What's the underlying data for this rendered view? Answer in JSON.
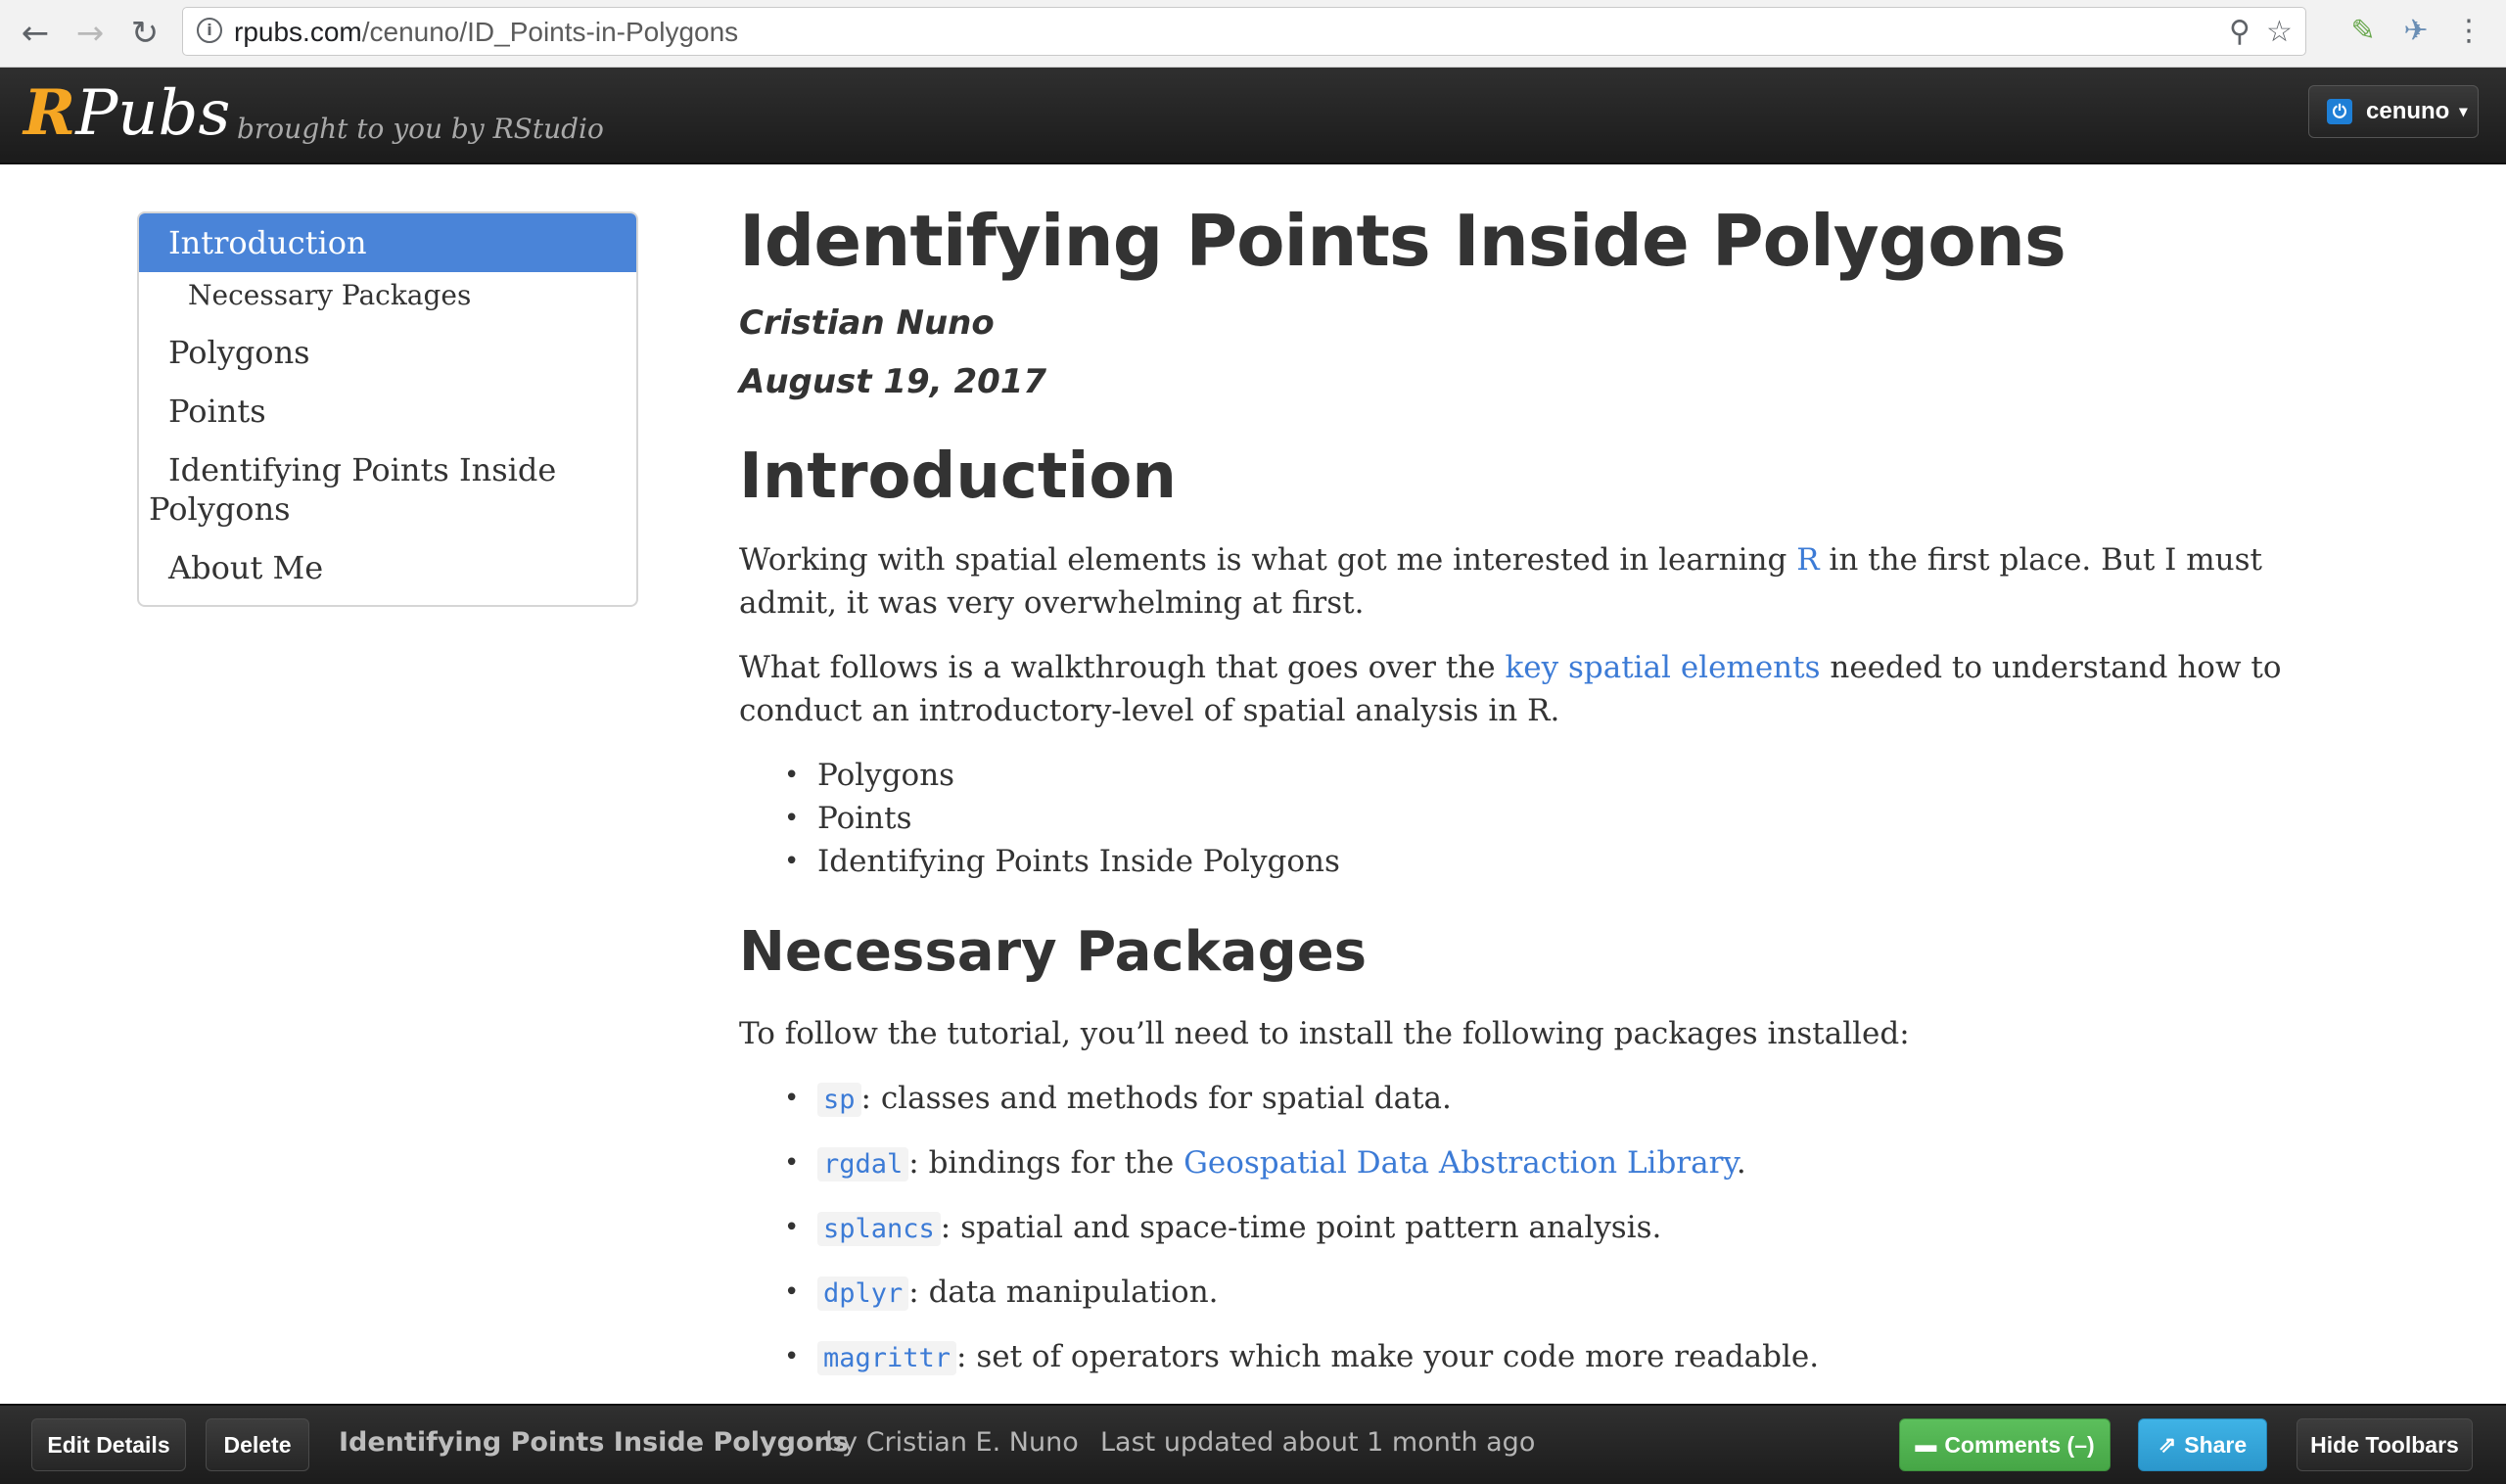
{
  "browser": {
    "url_host": "rpubs.com",
    "url_path": "/cenuno/ID_Points-in-Polygons",
    "back_icon": "←",
    "forward_icon": "→",
    "reload_icon": "↻",
    "info_icon": "i",
    "pin_icon": "⚲",
    "star_icon": "☆",
    "ext1_icon": "✎",
    "ext2_icon": "✈",
    "menu_icon": "⋮"
  },
  "header": {
    "logo_r": "R",
    "logo_rest": "Pubs",
    "tagline": "brought to you by RStudio",
    "user_name": "cenuno",
    "power_icon": "⏻",
    "caret_icon": "▾"
  },
  "toc": {
    "items": [
      {
        "label": "Introduction"
      },
      {
        "label": "Necessary Packages"
      },
      {
        "label": "Polygons"
      },
      {
        "label": "Points"
      },
      {
        "label": "Identifying Points Inside"
      },
      {
        "label": "Polygons"
      },
      {
        "label": "About Me"
      }
    ]
  },
  "doc": {
    "title": "Identifying Points Inside Polygons",
    "author": "Cristian Nuno",
    "date": "August 19, 2017",
    "intro_heading": "Introduction",
    "intro_p1_before": "Working with spatial elements is what got me interested in learning ",
    "intro_p1_link": "R",
    "intro_p1_after": " in the first place. But I must admit, it was very overwhelming at first.",
    "intro_p2_before": "What follows is a walkthrough that goes over the ",
    "intro_p2_link": "key spatial elements",
    "intro_p2_after": " needed to understand how to conduct an introductory-level of spatial analysis in R.",
    "intro_list": [
      "Polygons",
      "Points",
      "Identifying Points Inside Polygons"
    ],
    "packages_heading": "Necessary Packages",
    "packages_intro": "To follow the tutorial, you’ll need to install the following packages installed:",
    "packages": [
      {
        "code": "sp",
        "desc": ": classes and methods for spatial data.",
        "link": "",
        "after": ""
      },
      {
        "code": "rgdal",
        "desc": ": bindings for the ",
        "link": "Geospatial Data Abstraction Library",
        "after": "."
      },
      {
        "code": "splancs",
        "desc": ": spatial and space-time point pattern analysis.",
        "link": "",
        "after": ""
      },
      {
        "code": "dplyr",
        "desc": ": data manipulation.",
        "link": "",
        "after": ""
      },
      {
        "code": "magrittr",
        "desc": ": set of operators which make your code more readable.",
        "link": "",
        "after": ""
      }
    ],
    "bullet": "•"
  },
  "toolbar": {
    "edit_label": "Edit Details",
    "delete_label": "Delete",
    "doc_title": "Identifying Points Inside Polygons",
    "byline": "by Cristian E. Nuno",
    "updated": "Last updated about 1 month ago",
    "comments_label": "Comments (–)",
    "comments_icon": "▬",
    "share_label": "Share",
    "share_icon": "⇗",
    "hide_label": "Hide Toolbars"
  },
  "colors": {
    "accent": "#4a84d8",
    "logo_r": "#f5a623",
    "link": "#3c7bd6",
    "comments": "#4fb04f",
    "share": "#33a4da"
  }
}
